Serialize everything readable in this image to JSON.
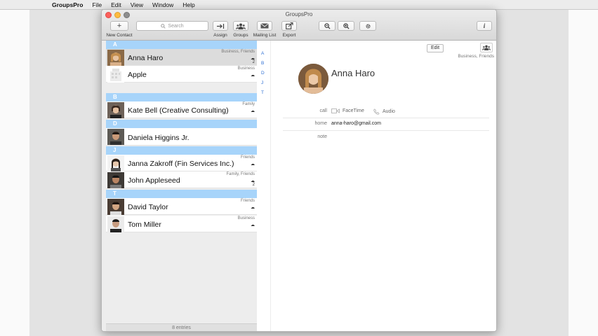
{
  "menubar": {
    "apple_icon": "apple-icon",
    "app_name": "GroupsPro",
    "items": [
      "File",
      "Edit",
      "View",
      "Window",
      "Help"
    ]
  },
  "window": {
    "title": "GroupsPro"
  },
  "toolbar": {
    "new_contact": {
      "label": "New Contact",
      "glyph": "+"
    },
    "search_placeholder": "Search",
    "assign": {
      "label": "Assign",
      "glyph": "→|"
    },
    "groups": {
      "label": "Groups"
    },
    "mailing_list": {
      "label": "Mailing List"
    },
    "export": {
      "label": "Export"
    },
    "zoom_out_icon": "zoom-out-icon",
    "zoom_in_icon": "zoom-in-icon",
    "settings_icon": "gear-icon",
    "info": {
      "glyph": "i"
    }
  },
  "sections": [
    "A",
    "B",
    "D",
    "J",
    "T"
  ],
  "contacts": [
    {
      "name": "Anna Haro",
      "tags": "Business, Friends",
      "count": "2",
      "selected": true
    },
    {
      "name": "Apple",
      "tags": "Business",
      "count": ""
    },
    {
      "name": "Kate Bell (Creative Consulting)",
      "tags": "Family",
      "count": ""
    },
    {
      "name": "Daniela Higgins Jr.",
      "tags": "",
      "count": ""
    },
    {
      "name": "Janna Zakroff (Fin Services Inc.)",
      "tags": "Friends",
      "count": ""
    },
    {
      "name": "John Appleseed",
      "tags": "Family, Friends",
      "count": "2"
    },
    {
      "name": "David Taylor",
      "tags": "Friends",
      "count": ""
    },
    {
      "name": "Tom Miller",
      "tags": "Business",
      "count": ""
    }
  ],
  "list_footer": "8 entries",
  "index_letters": [
    "A",
    "B",
    "D",
    "J",
    "T"
  ],
  "detail": {
    "edit_label": "Edit",
    "groups_text": "Business, Friends",
    "name": "Anna Haro",
    "call_label": "call",
    "facetime_label": "FaceTime",
    "audio_label": "Audio",
    "home_label": "home",
    "home_value": "anna-haro@gmail.com",
    "note_label": "note"
  },
  "colors": {
    "section_header": "#a7d4fa",
    "index_letter": "#2e6fd4",
    "selected_row": "#dcdcdc"
  }
}
